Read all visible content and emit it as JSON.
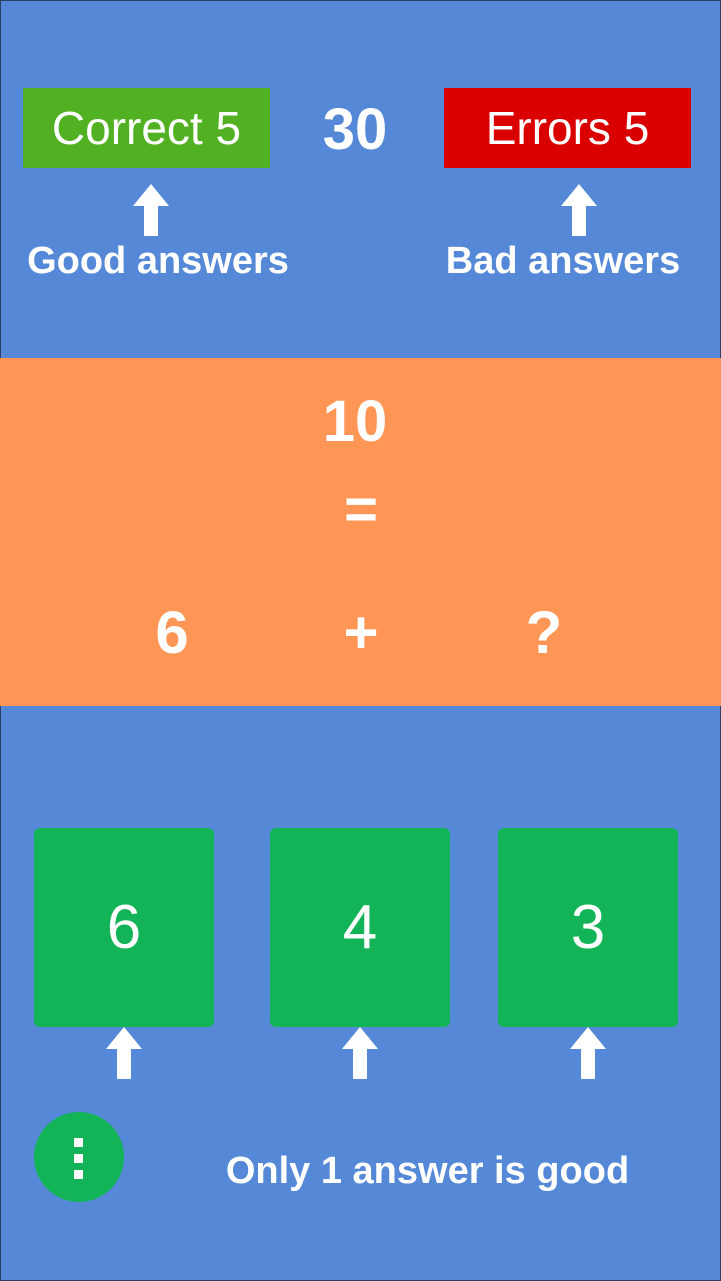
{
  "scoreboard": {
    "correct_label": "Correct 5",
    "errors_label": "Errors 5",
    "timer": "30",
    "good_hint": "Good answers",
    "bad_hint": "Bad answers"
  },
  "equation": {
    "result": "10",
    "equals": "=",
    "left_operand": "6",
    "operator": "+",
    "unknown": "?"
  },
  "answers": [
    "6",
    "4",
    "3"
  ],
  "footer": {
    "hint": "Only 1 answer is good",
    "menu_icon": "more-vertical-icon"
  },
  "colors": {
    "background": "#5589d8",
    "equation_band": "#ff9656",
    "correct": "#52b122",
    "errors": "#db0000",
    "answer_tile": "#12b457"
  }
}
